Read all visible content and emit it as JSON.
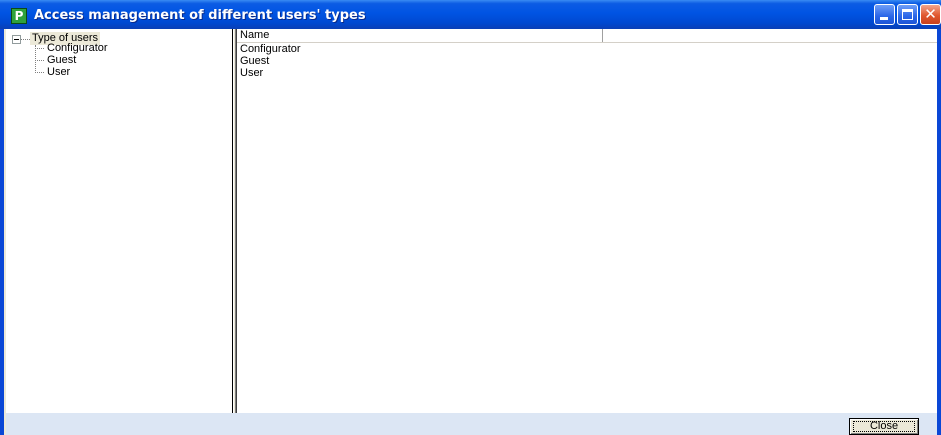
{
  "window": {
    "title": "Access management of different users' types",
    "app_icon_letter": "P",
    "close_glyph": "✕"
  },
  "tree": {
    "root_label": "Type of users",
    "children": [
      {
        "label": "Configurator"
      },
      {
        "label": "Guest"
      },
      {
        "label": "User"
      }
    ]
  },
  "list": {
    "columns": [
      "Name"
    ],
    "rows": [
      "Configurator",
      "Guest",
      "User"
    ]
  },
  "footer": {
    "close_label": "Close"
  },
  "colors": {
    "titlebar": "#0054e3",
    "window_border": "#0a47d6",
    "footer_bg": "#dce6f4"
  }
}
